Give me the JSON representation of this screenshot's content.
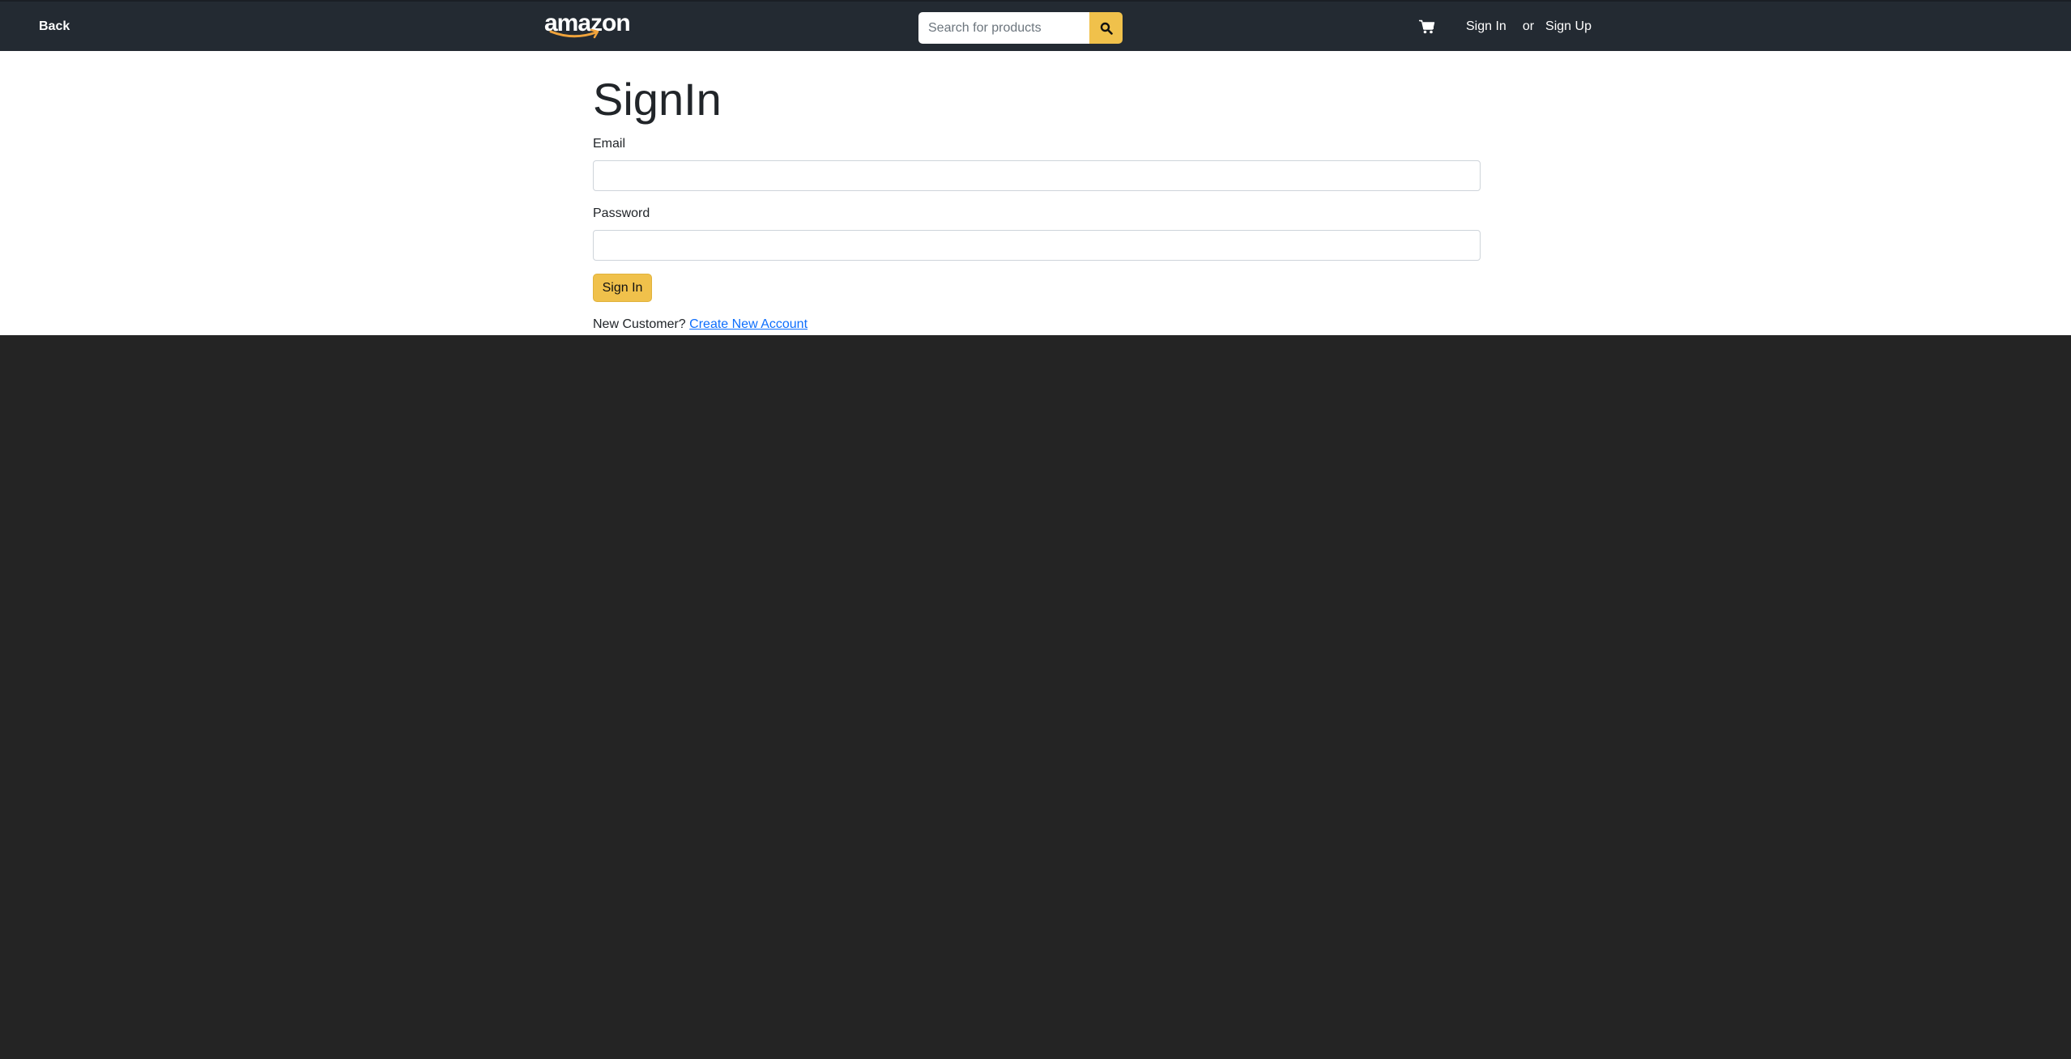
{
  "header": {
    "back_label": "Back",
    "logo_text": "amazon",
    "search": {
      "placeholder": "Search for products",
      "value": ""
    },
    "search_icon": "search-icon",
    "cart_icon": "cart-icon",
    "signin_label": "Sign In",
    "or_label": "or",
    "signup_label": "Sign Up"
  },
  "form": {
    "title": "SignIn",
    "email_label": "Email",
    "email_value": "",
    "password_label": "Password",
    "password_value": "",
    "submit_label": "Sign In",
    "new_customer_text": "New Customer?",
    "create_account_label": "Create New Account"
  },
  "colors": {
    "navbar": "#232a32",
    "accent": "#f0c14b",
    "page_background": "#242424",
    "link": "#0d6efd"
  }
}
